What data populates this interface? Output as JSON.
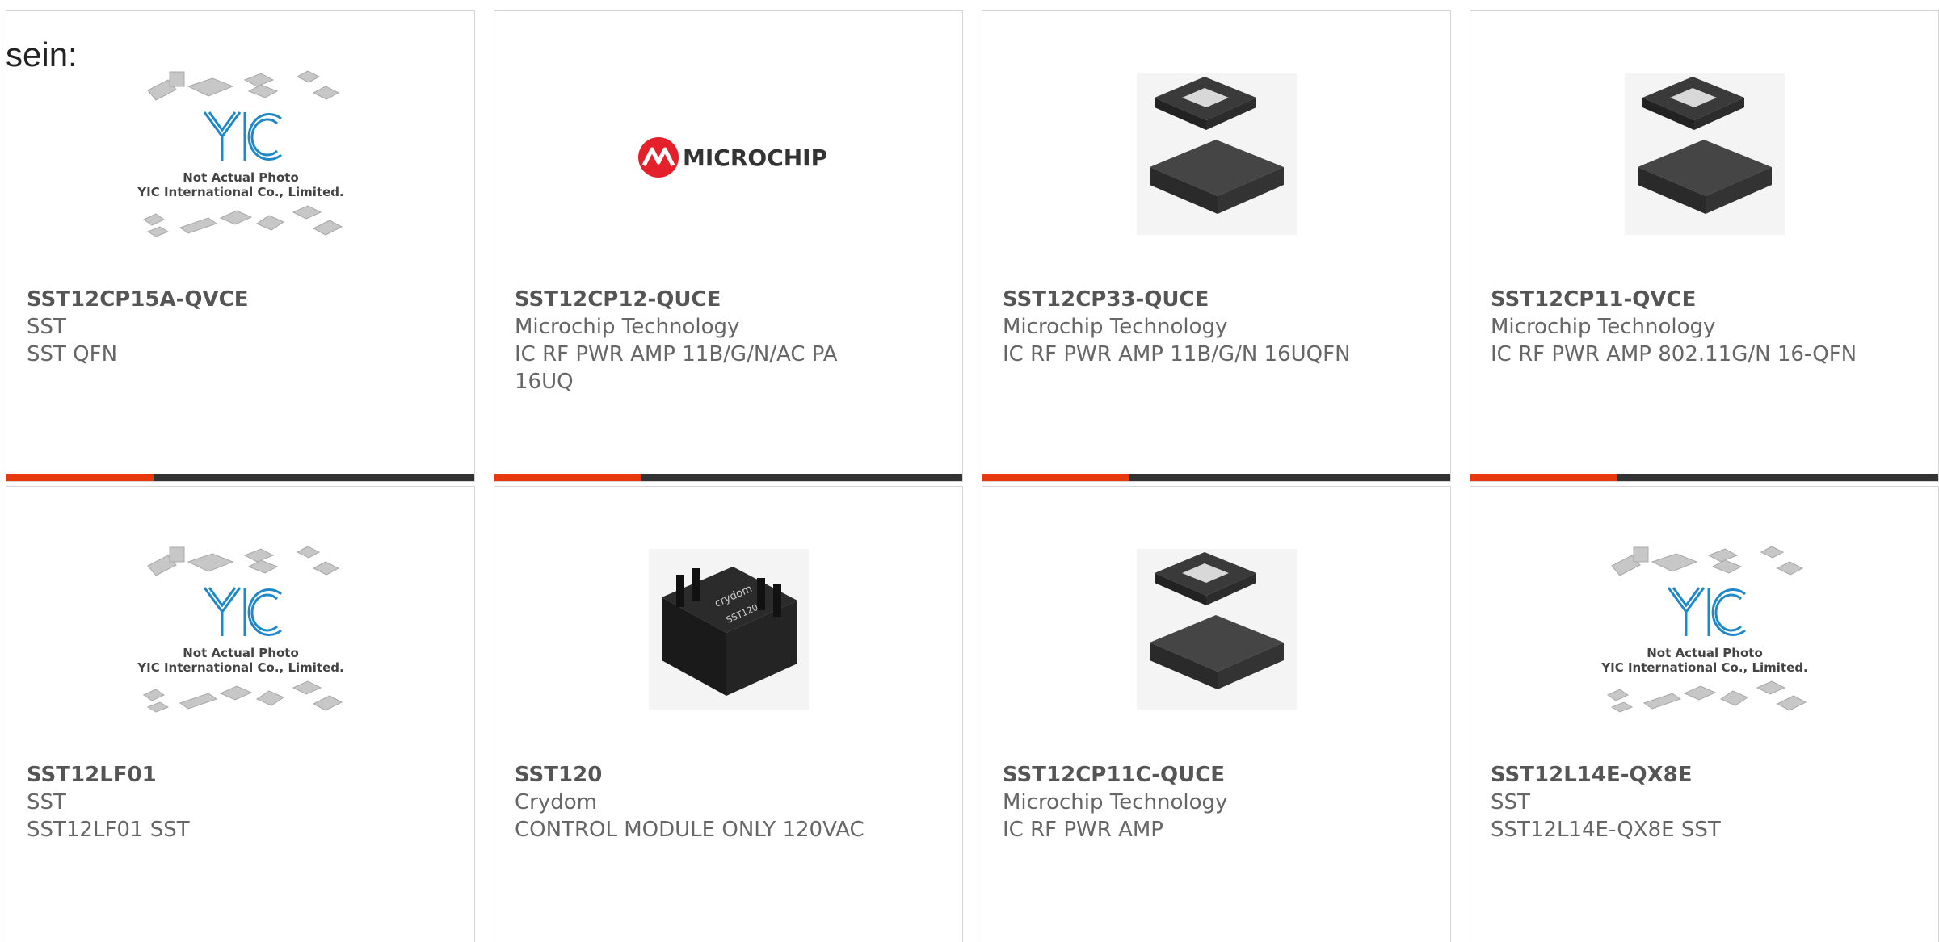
{
  "lead_text": "sein:",
  "placeholder_caption": {
    "line1": "Not Actual Photo",
    "line2": "YIC International Co., Limited.",
    "brand": "YIC"
  },
  "microchip_logo_text": "MICROCHIP",
  "relay_labels": {
    "brand": "crydom",
    "model": "SST120"
  },
  "products": [
    {
      "part": "SST12CP15A-QVCE",
      "manufacturer": "SST",
      "description": "SST QFN",
      "image": "yic-placeholder"
    },
    {
      "part": "SST12CP12-QUCE",
      "manufacturer": "Microchip Technology",
      "description": "IC RF PWR AMP 11B/G/N/AC PA 16UQ",
      "image": "microchip-logo"
    },
    {
      "part": "SST12CP33-QUCE",
      "manufacturer": "Microchip Technology",
      "description": "IC RF PWR AMP 11B/G/N 16UQFN",
      "image": "qfn-chip"
    },
    {
      "part": "SST12CP11-QVCE",
      "manufacturer": "Microchip Technology",
      "description": "IC RF PWR AMP 802.11G/N 16-QFN",
      "image": "qfn-chip"
    },
    {
      "part": "SST12LF01",
      "manufacturer": "SST",
      "description": "SST12LF01 SST",
      "image": "yic-placeholder"
    },
    {
      "part": "SST120",
      "manufacturer": "Crydom",
      "description": "CONTROL MODULE ONLY 120VAC",
      "image": "relay-module"
    },
    {
      "part": "SST12CP11C-QUCE",
      "manufacturer": "Microchip Technology",
      "description": "IC RF PWR AMP",
      "image": "qfn-chip"
    },
    {
      "part": "SST12L14E-QX8E",
      "manufacturer": "SST",
      "description": "SST12L14E-QX8E SST",
      "image": "yic-placeholder"
    }
  ],
  "colors": {
    "accent": "#e8380d",
    "bar": "#333333",
    "text": "#666666",
    "microchip_red": "#e4202b",
    "yic_blue": "#1e88c8"
  }
}
